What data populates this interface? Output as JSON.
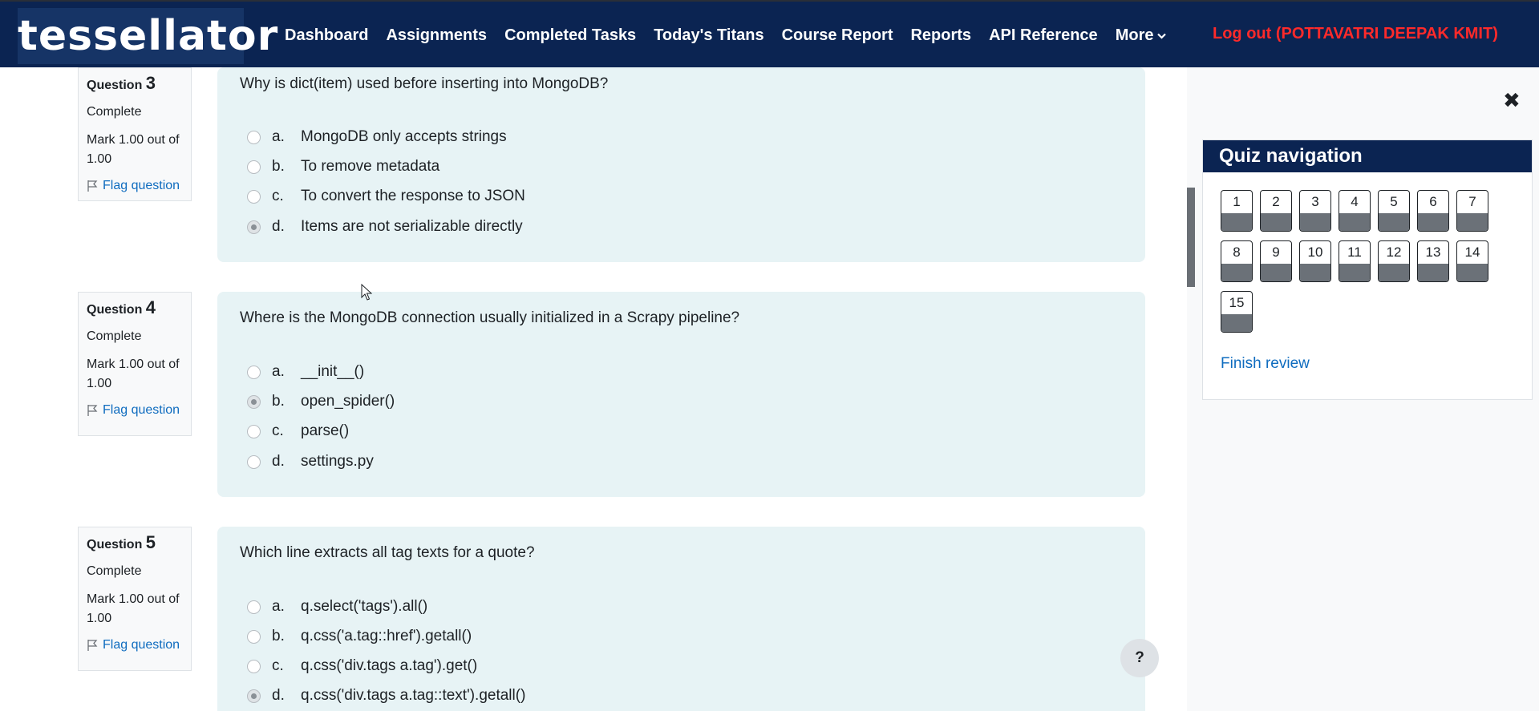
{
  "header": {
    "logo": "tessellator",
    "nav": [
      {
        "label": "Dashboard"
      },
      {
        "label": "Assignments"
      },
      {
        "label": "Completed Tasks"
      },
      {
        "label": "Today's Titans"
      },
      {
        "label": "Course Report"
      },
      {
        "label": "Reports"
      },
      {
        "label": "API Reference"
      },
      {
        "label": "More"
      }
    ],
    "logout": "Log out (POTTAVATRI DEEPAK KMIT)"
  },
  "questions": [
    {
      "label": "Question",
      "number": "3",
      "state": "Complete",
      "mark": "Mark 1.00 out of 1.00",
      "flag": "Flag question",
      "text": "Why is dict(item) used before inserting into MongoDB?",
      "options": [
        {
          "letter": "a.",
          "text": "MongoDB only accepts strings",
          "selected": false
        },
        {
          "letter": "b.",
          "text": "To remove metadata",
          "selected": false
        },
        {
          "letter": "c.",
          "text": "To convert the response to JSON",
          "selected": false
        },
        {
          "letter": "d.",
          "text": "Items are not serializable directly",
          "selected": true
        }
      ]
    },
    {
      "label": "Question",
      "number": "4",
      "state": "Complete",
      "mark": "Mark 1.00 out of 1.00",
      "flag": "Flag question",
      "text": "Where is the MongoDB connection usually initialized in a Scrapy pipeline?",
      "options": [
        {
          "letter": "a.",
          "text": "__init__()",
          "selected": false
        },
        {
          "letter": "b.",
          "text": "open_spider()",
          "selected": true
        },
        {
          "letter": "c.",
          "text": "parse()",
          "selected": false
        },
        {
          "letter": "d.",
          "text": "settings.py",
          "selected": false
        }
      ]
    },
    {
      "label": "Question",
      "number": "5",
      "state": "Complete",
      "mark": "Mark 1.00 out of 1.00",
      "flag": "Flag question",
      "text": "Which line extracts all tag texts for a quote?",
      "options": [
        {
          "letter": "a.",
          "text": "q.select('tags').all()",
          "selected": false
        },
        {
          "letter": "b.",
          "text": "q.css('a.tag::href').getall()",
          "selected": false
        },
        {
          "letter": "c.",
          "text": "q.css('div.tags a.tag').get()",
          "selected": false
        },
        {
          "letter": "d.",
          "text": "q.css('div.tags a.tag::text').getall()",
          "selected": true
        }
      ]
    }
  ],
  "quiz_nav": {
    "title": "Quiz navigation",
    "buttons": [
      "1",
      "2",
      "3",
      "4",
      "5",
      "6",
      "7",
      "8",
      "9",
      "10",
      "11",
      "12",
      "13",
      "14",
      "15"
    ],
    "finish": "Finish review"
  },
  "drawer": {
    "close_icon": "close-icon",
    "close_glyph": "✖"
  },
  "help": {
    "label": "?"
  }
}
